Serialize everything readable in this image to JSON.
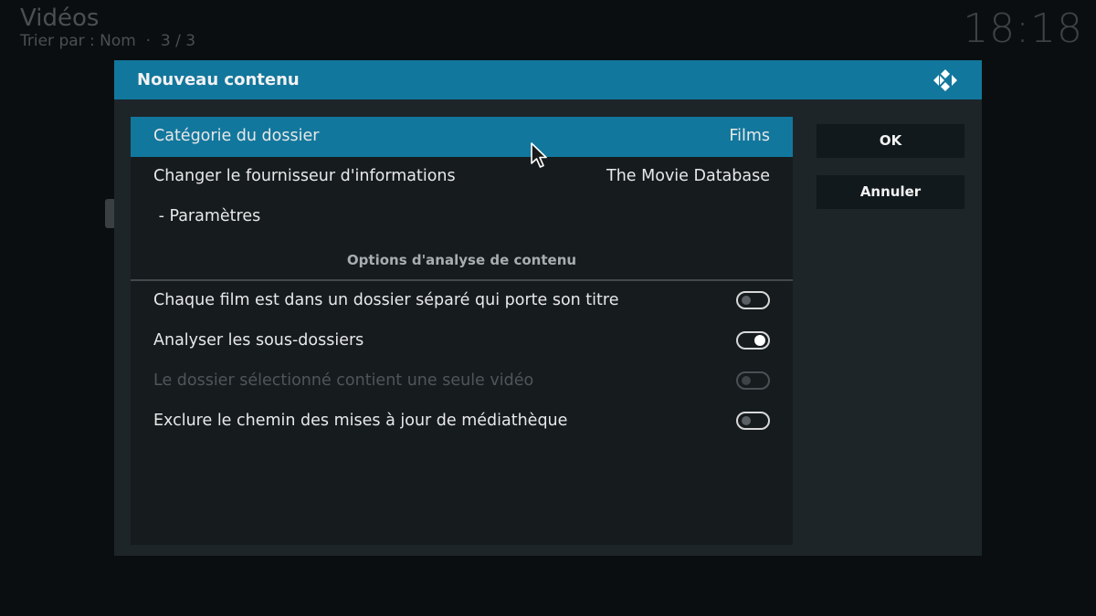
{
  "background": {
    "title": "Vidéos",
    "subtitle": "Trier par : Nom  ·  3 / 3",
    "clock": "18:18"
  },
  "dialog": {
    "title": "Nouveau contenu",
    "logo": "kodi-logo-icon",
    "rows": {
      "category": {
        "label": "Catégorie du dossier",
        "value": "Films"
      },
      "provider": {
        "label": "Changer le fournisseur d'informations",
        "value": "The Movie Database"
      },
      "settings": {
        "label": " - Paramètres"
      }
    },
    "section_title": "Options d'analyse de contenu",
    "options": {
      "separate_folder": {
        "label": "Chaque film est dans un dossier séparé qui porte son titre",
        "enabled": false
      },
      "subfolders": {
        "label": "Analyser les sous-dossiers",
        "enabled": true
      },
      "single_video": {
        "label": "Le dossier sélectionné contient une seule vidéo",
        "enabled": false,
        "disabled": true
      },
      "exclude_path": {
        "label": "Exclure le chemin des mises à jour de médiathèque",
        "enabled": false
      }
    },
    "buttons": {
      "ok": "OK",
      "cancel": "Annuler"
    }
  },
  "colors": {
    "accent": "#12779d",
    "dialog_bg": "#1e2529",
    "list_bg": "#161b1e"
  }
}
